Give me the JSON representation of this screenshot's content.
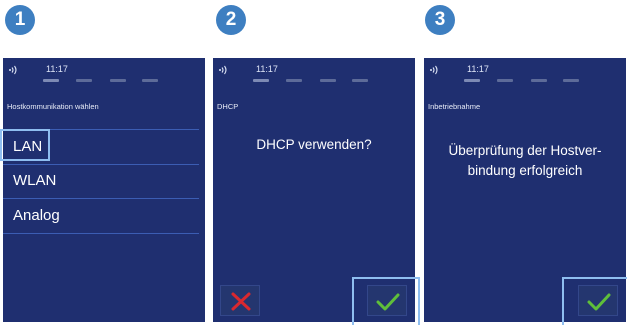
{
  "steps": [
    "1",
    "2",
    "3"
  ],
  "status": {
    "time": "11:17"
  },
  "screen1": {
    "title": "Hostkommunikation wählen",
    "items": [
      "LAN",
      "WLAN",
      "Analog"
    ]
  },
  "screen2": {
    "title": "DHCP",
    "question": "DHCP verwenden?"
  },
  "screen3": {
    "title": "Inbetriebnahme",
    "message_line1": "Überprüfung der Hostver-",
    "message_line2": "bindung erfolgreich"
  },
  "colors": {
    "screen_bg": "#1f2f70",
    "step_badge": "#3e7fc1",
    "highlight": "#8fbef0",
    "confirm": "#5fbf3a",
    "cancel": "#d9282f"
  },
  "icons": {
    "wifi": "contactless-icon",
    "confirm": "checkmark-icon",
    "cancel": "x-icon"
  }
}
